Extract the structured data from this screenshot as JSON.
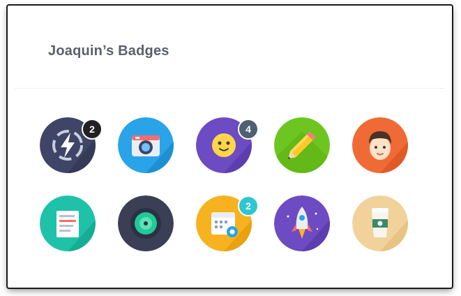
{
  "header": {
    "title": "Joaquin’s Badges"
  },
  "badges": [
    {
      "icon": "lightning-icon",
      "bg": "#3f4566",
      "count": "2",
      "count_color": "#222222"
    },
    {
      "icon": "camera-icon",
      "bg": "#2aa3e8",
      "count": null
    },
    {
      "icon": "smiley-icon",
      "bg": "#6d4bc2",
      "count": "4",
      "count_color": "#4f6070"
    },
    {
      "icon": "pencil-icon",
      "bg": "#6cc61f",
      "count": null
    },
    {
      "icon": "avatar-face-icon",
      "bg": "#f06a35",
      "count": null
    },
    {
      "icon": "document-icon",
      "bg": "#1fc2a8",
      "count": null
    },
    {
      "icon": "vinyl-record-icon",
      "bg": "#3a3f55",
      "count": null
    },
    {
      "icon": "calendar-icon",
      "bg": "#f7b21f",
      "count": "2",
      "count_color": "#2ec6d1"
    },
    {
      "icon": "rocket-icon",
      "bg": "#6d4bc2",
      "count": null
    },
    {
      "icon": "coffee-cup-icon",
      "bg": "#f1d29a",
      "count": null
    }
  ]
}
